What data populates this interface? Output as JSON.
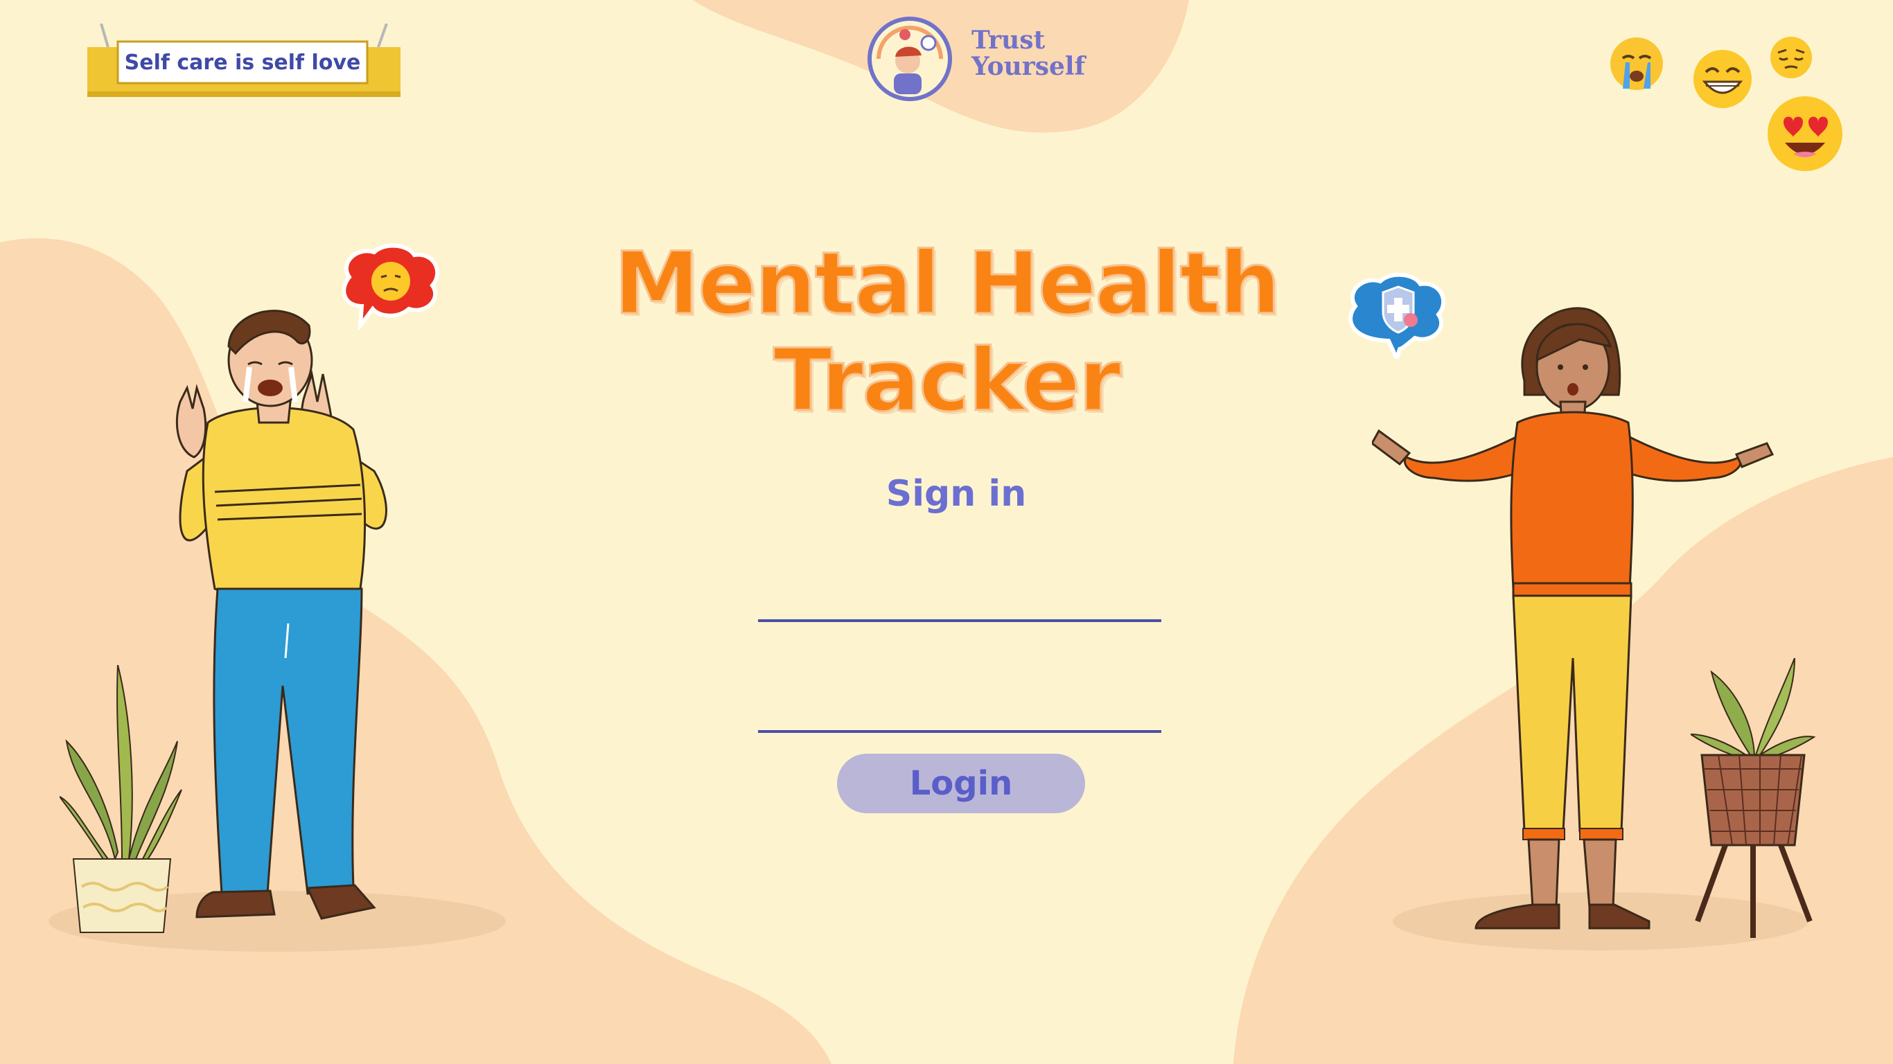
{
  "sign": {
    "text": "Self care is self love"
  },
  "logo": {
    "line1": "Trust",
    "line2": "Yourself"
  },
  "title": {
    "line1": "Mental Health",
    "line2": "Tracker"
  },
  "signin": {
    "heading": "Sign in",
    "username_value": "",
    "password_value": "",
    "login_label": "Login"
  },
  "colors": {
    "background": "#fdf4cf",
    "blob": "#fbd9b2",
    "title_orange": "#f98414",
    "accent_purple": "#6b6fd1",
    "input_line": "#4a4fa6",
    "button_bg": "#b9b6d8"
  },
  "icons": [
    "crying-emoji-icon",
    "grinning-emoji-icon",
    "pensive-emoji-icon",
    "heart-eyes-emoji-icon",
    "sad-thought-bubble-icon",
    "health-shield-bubble-icon"
  ]
}
